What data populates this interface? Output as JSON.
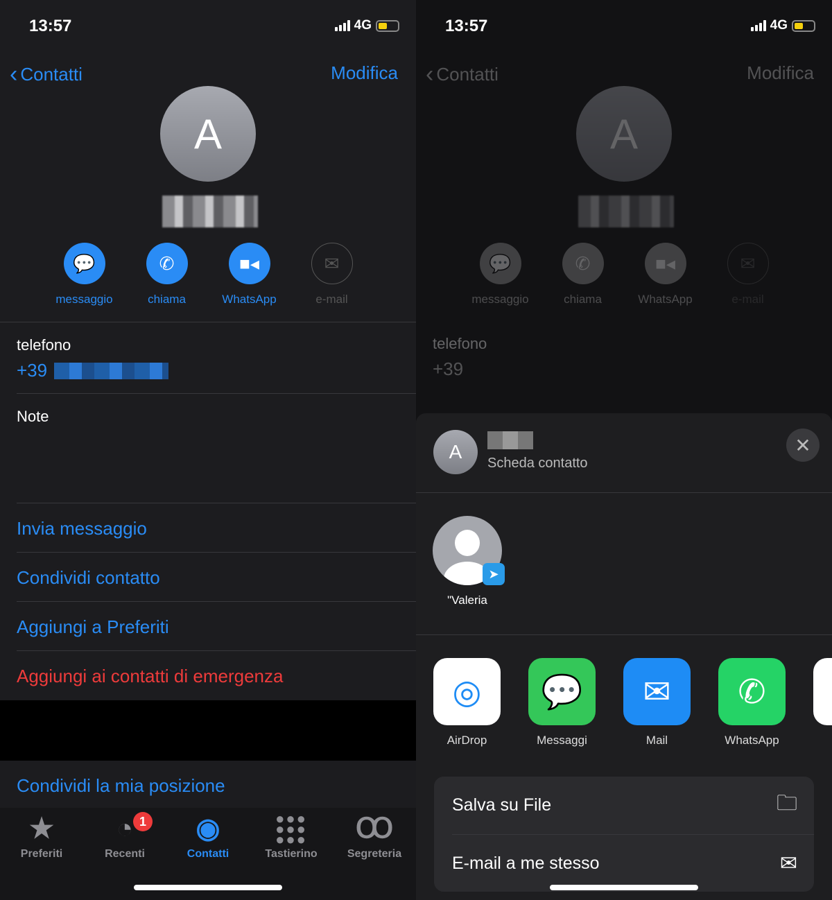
{
  "left": {
    "status": {
      "time": "13:57",
      "network": "4G"
    },
    "nav": {
      "back": "Contatti",
      "edit": "Modifica"
    },
    "contact": {
      "initial": "A"
    },
    "actions": [
      {
        "label": "messaggio",
        "icon": "message-icon",
        "enabled": true
      },
      {
        "label": "chiama",
        "icon": "phone-icon",
        "enabled": true
      },
      {
        "label": "WhatsApp",
        "icon": "video-icon",
        "enabled": true
      },
      {
        "label": "e-mail",
        "icon": "mail-icon",
        "enabled": false
      }
    ],
    "phone": {
      "label": "telefono",
      "prefix": "+39"
    },
    "notes_label": "Note",
    "links": [
      "Invia messaggio",
      "Condividi contatto",
      "Aggiungi a Preferiti"
    ],
    "emergency": "Aggiungi ai contatti di emergenza",
    "share_location": "Condividi la mia posizione",
    "tabs": [
      {
        "label": "Preferiti",
        "icon": "star-icon"
      },
      {
        "label": "Recenti",
        "icon": "clock-icon",
        "badge": "1"
      },
      {
        "label": "Contatti",
        "icon": "person-circle-icon",
        "active": true
      },
      {
        "label": "Tastierino",
        "icon": "keypad-icon"
      },
      {
        "label": "Segreteria",
        "icon": "voicemail-icon"
      }
    ]
  },
  "right": {
    "status": {
      "time": "13:57",
      "network": "4G"
    },
    "nav": {
      "back": "Contatti",
      "edit": "Modifica"
    },
    "sheet": {
      "initial": "A",
      "subtitle": "Scheda contatto",
      "suggestion": "\"Valeria",
      "apps": [
        {
          "label": "AirDrop",
          "color": "#ffffff"
        },
        {
          "label": "Messaggi",
          "color": "#34c759"
        },
        {
          "label": "Mail",
          "color": "#1e8cf5"
        },
        {
          "label": "WhatsApp",
          "color": "#25d366"
        }
      ],
      "options": [
        {
          "label": "Salva su File",
          "icon": "folder-icon"
        },
        {
          "label": "E-mail a me stesso",
          "icon": "mail-tray-icon"
        }
      ]
    }
  },
  "colors": {
    "accent": "#2a8cf5",
    "destructive": "#ee3b3b"
  }
}
